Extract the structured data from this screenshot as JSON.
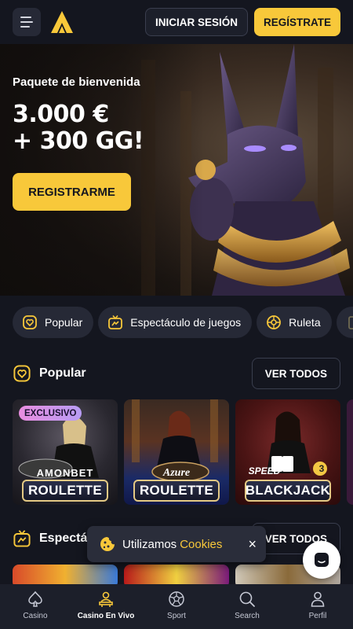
{
  "header": {
    "login_label": "INICIAR SESIÓN",
    "register_label": "REGÍSTRATE",
    "brand_color": "#f8c83a"
  },
  "hero": {
    "subtitle": "Paquete de bienvenida",
    "title_line1": "3.000 €",
    "title_line2": "+ 300 GG!",
    "cta_label": "REGISTRARME"
  },
  "categories": [
    {
      "label": "Popular",
      "icon": "heart-shield-icon"
    },
    {
      "label": "Espectáculo de juegos",
      "icon": "tv-icon"
    },
    {
      "label": "Ruleta",
      "icon": "roulette-icon"
    }
  ],
  "sections": {
    "popular": {
      "title": "Popular",
      "see_all_label": "VER TODOS"
    },
    "shows": {
      "title": "Espectác",
      "see_all_label": "VER TODOS"
    }
  },
  "games": [
    {
      "badge": "EXCLUSIVO",
      "brand": "AMONBET",
      "name": "ROULETTE"
    },
    {
      "brand": "Azure",
      "name": "ROULETTE"
    },
    {
      "brand": "SPEED",
      "name": "BLACKJACK",
      "seat": "3"
    }
  ],
  "cookie_toast": {
    "text": "Utilizamos",
    "link": "Cookies",
    "close": "×"
  },
  "bottom_nav": [
    {
      "label": "Casino",
      "icon": "spade-icon"
    },
    {
      "label": "Casino En Vivo",
      "icon": "dealer-icon",
      "active": true
    },
    {
      "label": "Sport",
      "icon": "soccer-ball-icon"
    },
    {
      "label": "Search",
      "icon": "search-icon"
    },
    {
      "label": "Perfil",
      "icon": "user-icon"
    }
  ]
}
